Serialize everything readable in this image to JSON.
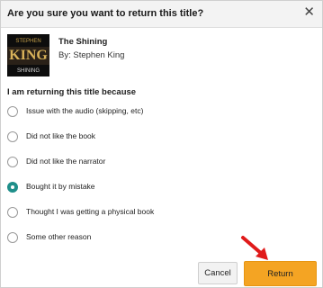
{
  "dialog": {
    "title": "Are you sure you want to return this title?",
    "close_glyph": "✕"
  },
  "book": {
    "title": "The Shining",
    "author": "By: Stephen King",
    "cover_text_top": "STEPHEN",
    "cover_text_main": "KING",
    "cover_text_bottom": "SHINING"
  },
  "question": "I am returning this title because",
  "options": [
    {
      "label": "Issue with the audio (skipping, etc)",
      "selected": false
    },
    {
      "label": "Did not like the book",
      "selected": false
    },
    {
      "label": "Did not like the narrator",
      "selected": false
    },
    {
      "label": "Bought it by mistake",
      "selected": true
    },
    {
      "label": "Thought I was getting a physical book",
      "selected": false
    },
    {
      "label": "Some other reason",
      "selected": false
    }
  ],
  "buttons": {
    "cancel_label": "Cancel",
    "return_label": "Return"
  },
  "colors": {
    "accent": "#1f8f8a",
    "return_button": "#f4a423",
    "arrow": "#e01a1a"
  },
  "icons": {
    "close": "close-icon",
    "arrow": "red-arrow-icon"
  }
}
